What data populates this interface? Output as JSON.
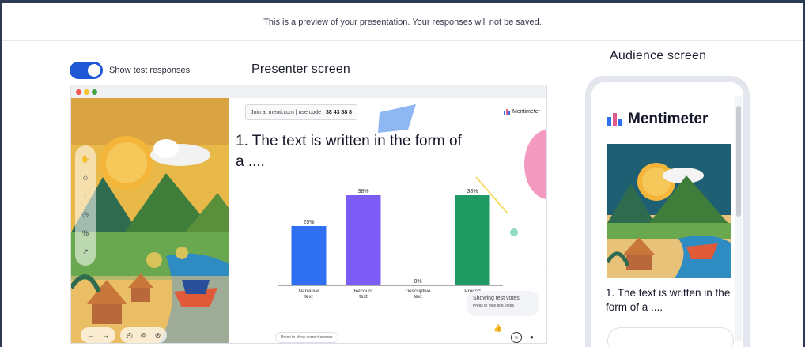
{
  "banner": {
    "text": "This is a preview of your presentation. Your responses will not be saved."
  },
  "toggle": {
    "label": "Show test responses",
    "on": true
  },
  "presenter": {
    "heading": "Presenter screen",
    "join": {
      "text": "Join at menti.com | use code",
      "code": "38 43 88 8"
    },
    "brand": "Mentimeter",
    "question": "1. The text is written in the form of a ....",
    "votes_box": {
      "title": "Showing test votes",
      "hint": "Press to hide test votes"
    },
    "press_hint": "Press to show correct answer"
  },
  "chart_data": {
    "type": "bar",
    "categories": [
      "Narrative text",
      "Recount text",
      "Descriptive text",
      "Procedure text"
    ],
    "values": [
      25,
      38,
      0,
      38
    ],
    "value_labels": [
      "25%",
      "38%",
      "0%",
      "38%"
    ],
    "tick_labels": [
      [
        "Narrative",
        "text"
      ],
      [
        "Recount",
        "text"
      ],
      [
        "Descriptive",
        "text"
      ],
      [
        "Proced",
        "text"
      ]
    ],
    "colors": [
      "#2f6ff2",
      "#7b5cf5",
      "#e06fa0",
      "#1f9a62"
    ],
    "ylim": [
      0,
      40
    ]
  },
  "audience": {
    "heading": "Audience screen",
    "brand": "Mentimeter",
    "question": "1. The text is written in the form of a ...."
  },
  "colors": {
    "accent": "#1f57d6",
    "frame": "#2d3b52"
  }
}
